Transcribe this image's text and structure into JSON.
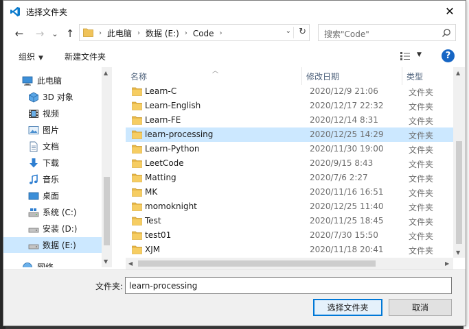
{
  "window": {
    "title": "选择文件夹",
    "close_glyph": "✕"
  },
  "nav": {
    "back_glyph": "←",
    "forward_glyph": "→",
    "recent_glyph": "⌄",
    "up_glyph": "↑",
    "breadcrumbs": [
      "此电脑",
      "数据 (E:)",
      "Code"
    ],
    "separator": "›",
    "dropdown_glyph": "⌄",
    "refresh_glyph": "↻"
  },
  "search": {
    "placeholder": "搜索\"Code\""
  },
  "toolbar": {
    "organize_label": "组织",
    "caret": "▼",
    "new_folder_label": "新建文件夹",
    "help_glyph": "?"
  },
  "sidebar": {
    "items": [
      {
        "label": "此电脑",
        "icon": "computer-icon",
        "indent": 0
      },
      {
        "label": "3D 对象",
        "icon": "3d-objects-icon",
        "indent": 1
      },
      {
        "label": "视频",
        "icon": "video-icon",
        "indent": 1
      },
      {
        "label": "图片",
        "icon": "pictures-icon",
        "indent": 1
      },
      {
        "label": "文档",
        "icon": "documents-icon",
        "indent": 1
      },
      {
        "label": "下载",
        "icon": "download-icon",
        "indent": 1
      },
      {
        "label": "音乐",
        "icon": "music-icon",
        "indent": 1
      },
      {
        "label": "桌面",
        "icon": "desktop-icon",
        "indent": 1
      },
      {
        "label": "系统 (C:)",
        "icon": "windows-drive-icon",
        "indent": 1
      },
      {
        "label": "安装 (D:)",
        "icon": "drive-icon",
        "indent": 1
      },
      {
        "label": "数据 (E:)",
        "icon": "drive-icon",
        "indent": 1,
        "selected": true
      },
      {
        "label": "网络",
        "icon": "network-icon",
        "indent": 0
      }
    ]
  },
  "columns": {
    "name": "名称",
    "modified": "修改日期",
    "type": "类型"
  },
  "files": [
    {
      "name": "Learn-C",
      "modified": "2020/12/9 21:06",
      "type": "文件夹"
    },
    {
      "name": "Learn-English",
      "modified": "2020/12/17 22:32",
      "type": "文件夹"
    },
    {
      "name": "Learn-FE",
      "modified": "2020/12/14 8:31",
      "type": "文件夹"
    },
    {
      "name": "learn-processing",
      "modified": "2020/12/25 14:29",
      "type": "文件夹",
      "selected": true
    },
    {
      "name": "Learn-Python",
      "modified": "2020/11/30 19:00",
      "type": "文件夹"
    },
    {
      "name": "LeetCode",
      "modified": "2020/9/15 8:43",
      "type": "文件夹"
    },
    {
      "name": "Matting",
      "modified": "2020/7/6 2:27",
      "type": "文件夹"
    },
    {
      "name": "MK",
      "modified": "2020/11/16 16:51",
      "type": "文件夹"
    },
    {
      "name": "momoknight",
      "modified": "2020/12/25 11:40",
      "type": "文件夹"
    },
    {
      "name": "Test",
      "modified": "2020/11/25 18:45",
      "type": "文件夹"
    },
    {
      "name": "test01",
      "modified": "2020/7/30 15:50",
      "type": "文件夹"
    },
    {
      "name": "XJM",
      "modified": "2020/11/18 20:41",
      "type": "文件夹"
    }
  ],
  "bottom": {
    "folder_label": "文件夹:",
    "folder_value": "learn-processing",
    "select_button": "选择文件夹",
    "cancel_button": "取消"
  },
  "colors": {
    "selection": "#cce8ff",
    "folder": "#e8b84a",
    "accent": "#0078d7",
    "header_text": "#4c607a"
  }
}
